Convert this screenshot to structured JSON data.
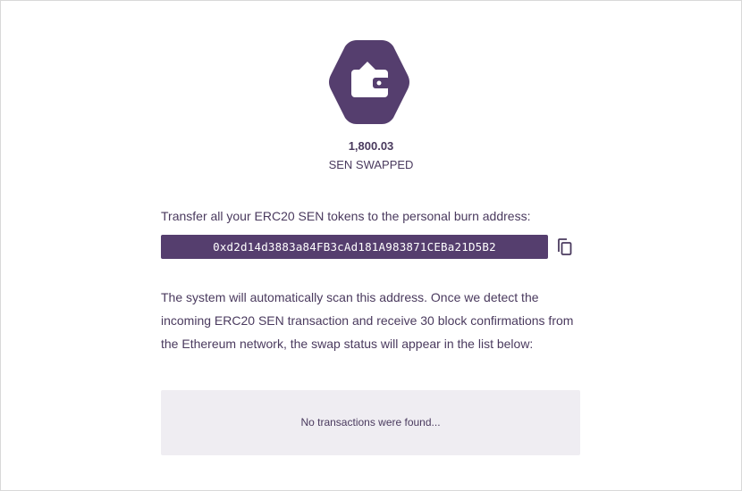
{
  "header": {
    "icon": "wallet-icon",
    "amount": "1,800.03",
    "amount_label": "SEN SWAPPED"
  },
  "burn": {
    "instruction": "Transfer all your ERC20 SEN tokens to the personal burn address:",
    "address": "0xd2d14d3883a84FB3cAd181A983871CEBa21D5B2",
    "copy_icon": "copy-icon"
  },
  "info": {
    "line1": "The system will automatically scan this address. Once we detect the",
    "line2": "incoming ERC20 SEN transaction and receive 30 block confirmations from",
    "line3": "the Ethereum network, the swap status will appear in the list below:"
  },
  "transactions": {
    "empty_message": "No transactions were found..."
  },
  "colors": {
    "brand": "#553e6e",
    "text": "#4a3a5e",
    "panel": "#efedf2"
  }
}
